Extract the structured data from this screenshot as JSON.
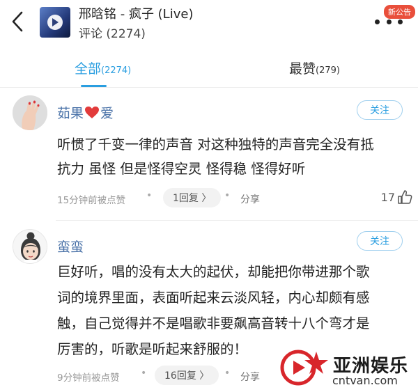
{
  "header": {
    "song_title": "邢晗铭 - 疯子 (Live)",
    "comment_count": "评论 (2274)",
    "new_badge": "新公告"
  },
  "tabs": [
    {
      "label": "全部",
      "count": "(2274)",
      "active": true
    },
    {
      "label": "最赞",
      "count": "(279)",
      "active": false
    }
  ],
  "comments": [
    {
      "username_before": "茹果",
      "username_after": "爱",
      "follow_label": "关注",
      "text_lines": [
        "听惯了千变一律的声音 对这种独特的声音完全没有抵",
        "抗力 虽怪 但是怪得空灵 怪得稳 怪得好听"
      ],
      "time": "15分钟前被点赞",
      "reply_label": "1回复 〉",
      "share_label": "分享",
      "likes": "17"
    },
    {
      "username": "蛮蛮",
      "follow_label": "关注",
      "text_lines": [
        "巨好听，唱的没有太大的起伏，却能把你带进那个歌",
        "词的境界里面，表面听起来云淡风轻，内心却颇有感",
        "触，自己觉得并不是唱歌非要飙高音转十八个弯才是",
        "厉害的，听歌是听起来舒服的！"
      ],
      "time": "9分钟前被点赞",
      "reply_label": "16回复 〉",
      "share_label": "分享"
    }
  ],
  "watermark": {
    "text": "亚洲娱乐",
    "url": "cntvan.com"
  },
  "colors": {
    "accent": "#2a9ee0",
    "username": "#4a72a8",
    "badge": "#e94f3b",
    "heart": "#e23b3b",
    "watermark_red": "#d8262b"
  }
}
